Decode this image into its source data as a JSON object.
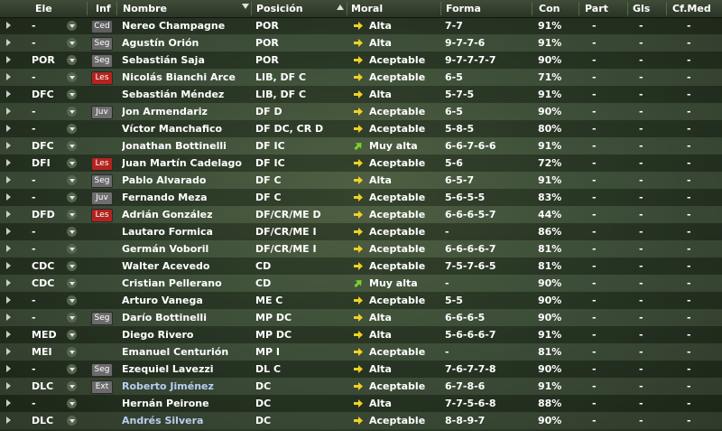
{
  "columns": {
    "ele": "Ele",
    "inf": "Inf",
    "nombre": "Nombre",
    "posicion": "Posición",
    "moral": "Moral",
    "forma": "Forma",
    "con": "Con",
    "part": "Part",
    "gls": "Gls",
    "cfmed": "Cf.Med"
  },
  "colors": {
    "badge_ced": "#5f5f5f",
    "badge_seg": "#6b6b6b",
    "badge_les": "#b3241e",
    "badge_juv": "#6e6e6e",
    "badge_ext": "#6b6b6b",
    "arrow_yellow": "#f2d024",
    "arrow_green": "#7ad12a",
    "link": "#b8cff2"
  },
  "players": [
    {
      "ele": "-",
      "inf": "Ced",
      "nombre": "Nereo Champagne",
      "posicion": "POR",
      "moral": "Alta",
      "forma": "7-7",
      "con": "91%",
      "part": "-",
      "gls": "-",
      "cf": "-"
    },
    {
      "ele": "-",
      "inf": "Seg",
      "nombre": "Agustín Orión",
      "posicion": "POR",
      "moral": "Alta",
      "forma": "9-7-7-6",
      "con": "91%",
      "part": "-",
      "gls": "-",
      "cf": "-"
    },
    {
      "ele": "POR",
      "inf": "Seg",
      "nombre": "Sebastián Saja",
      "posicion": "POR",
      "moral": "Aceptable",
      "forma": "9-7-7-7-7",
      "con": "90%",
      "part": "-",
      "gls": "-",
      "cf": "-"
    },
    {
      "ele": "-",
      "inf": "Les",
      "nombre": "Nicolás Bianchi Arce",
      "posicion": "LIB, DF C",
      "moral": "Aceptable",
      "forma": "6-5",
      "con": "71%",
      "part": "-",
      "gls": "-",
      "cf": "-"
    },
    {
      "ele": "DFC",
      "inf": "",
      "nombre": "Sebastián Méndez",
      "posicion": "LIB, DF C",
      "moral": "Alta",
      "forma": "5-7-5",
      "con": "91%",
      "part": "-",
      "gls": "-",
      "cf": "-"
    },
    {
      "ele": "-",
      "inf": "Juv",
      "nombre": "Jon Armendariz",
      "posicion": "DF D",
      "moral": "Aceptable",
      "forma": "6-5",
      "con": "90%",
      "part": "-",
      "gls": "-",
      "cf": "-"
    },
    {
      "ele": "-",
      "inf": "",
      "nombre": "Víctor Manchafico",
      "posicion": "DF DC, CR D",
      "moral": "Aceptable",
      "forma": "5-8-5",
      "con": "80%",
      "part": "-",
      "gls": "-",
      "cf": "-"
    },
    {
      "ele": "DFC",
      "inf": "",
      "nombre": "Jonathan Bottinelli",
      "posicion": "DF IC",
      "moral": "Muy alta",
      "forma": "6-6-7-6-6",
      "con": "91%",
      "part": "-",
      "gls": "-",
      "cf": "-"
    },
    {
      "ele": "DFI",
      "inf": "Les",
      "nombre": "Juan Martín Cadelago",
      "posicion": "DF IC",
      "moral": "Aceptable",
      "forma": "5-6",
      "con": "72%",
      "part": "-",
      "gls": "-",
      "cf": "-"
    },
    {
      "ele": "-",
      "inf": "Seg",
      "nombre": "Pablo Alvarado",
      "posicion": "DF C",
      "moral": "Alta",
      "forma": "6-5-7",
      "con": "91%",
      "part": "-",
      "gls": "-",
      "cf": "-"
    },
    {
      "ele": "-",
      "inf": "Juv",
      "nombre": "Fernando Meza",
      "posicion": "DF C",
      "moral": "Aceptable",
      "forma": "5-6-5-5",
      "con": "83%",
      "part": "-",
      "gls": "-",
      "cf": "-"
    },
    {
      "ele": "DFD",
      "inf": "Les",
      "nombre": "Adrián González",
      "posicion": "DF/CR/ME D",
      "moral": "Aceptable",
      "forma": "6-6-6-5-7",
      "con": "44%",
      "part": "-",
      "gls": "-",
      "cf": "-"
    },
    {
      "ele": "-",
      "inf": "",
      "nombre": "Lautaro Formica",
      "posicion": "DF/CR/ME I",
      "moral": "Aceptable",
      "forma": "-",
      "con": "86%",
      "part": "-",
      "gls": "-",
      "cf": "-"
    },
    {
      "ele": "-",
      "inf": "",
      "nombre": "Germán Voboril",
      "posicion": "DF/CR/ME I",
      "moral": "Aceptable",
      "forma": "6-6-6-6-7",
      "con": "81%",
      "part": "-",
      "gls": "-",
      "cf": "-"
    },
    {
      "ele": "CDC",
      "inf": "",
      "nombre": "Walter Acevedo",
      "posicion": "CD",
      "moral": "Aceptable",
      "forma": "7-5-7-6-5",
      "con": "81%",
      "part": "-",
      "gls": "-",
      "cf": "-"
    },
    {
      "ele": "CDC",
      "inf": "",
      "nombre": "Cristian Pellerano",
      "posicion": "CD",
      "moral": "Muy alta",
      "forma": "-",
      "con": "90%",
      "part": "-",
      "gls": "-",
      "cf": "-"
    },
    {
      "ele": "-",
      "inf": "",
      "nombre": "Arturo Vanega",
      "posicion": "ME C",
      "moral": "Aceptable",
      "forma": "5-5",
      "con": "90%",
      "part": "-",
      "gls": "-",
      "cf": "-"
    },
    {
      "ele": "-",
      "inf": "Seg",
      "nombre": "Darío Bottinelli",
      "posicion": "MP DC",
      "moral": "Alta",
      "forma": "6-6-6-5",
      "con": "90%",
      "part": "-",
      "gls": "-",
      "cf": "-"
    },
    {
      "ele": "MED",
      "inf": "",
      "nombre": "Diego Rivero",
      "posicion": "MP DC",
      "moral": "Alta",
      "forma": "5-6-6-6-7",
      "con": "91%",
      "part": "-",
      "gls": "-",
      "cf": "-"
    },
    {
      "ele": "MEI",
      "inf": "",
      "nombre": "Emanuel Centurión",
      "posicion": "MP I",
      "moral": "Aceptable",
      "forma": "-",
      "con": "81%",
      "part": "-",
      "gls": "-",
      "cf": "-"
    },
    {
      "ele": "-",
      "inf": "Seg",
      "nombre": "Ezequiel Lavezzi",
      "posicion": "DL C",
      "moral": "Alta",
      "forma": "7-6-7-7-8",
      "con": "90%",
      "part": "-",
      "gls": "-",
      "cf": "-"
    },
    {
      "ele": "DLC",
      "inf": "Ext",
      "nombre": "Roberto Jiménez",
      "posicion": "DC",
      "moral": "Aceptable",
      "forma": "6-7-8-6",
      "con": "91%",
      "part": "-",
      "gls": "-",
      "cf": "-",
      "link": true
    },
    {
      "ele": "-",
      "inf": "",
      "nombre": "Hernán Peirone",
      "posicion": "DC",
      "moral": "Alta",
      "forma": "7-7-5-6-8",
      "con": "88%",
      "part": "-",
      "gls": "-",
      "cf": "-"
    },
    {
      "ele": "DLC",
      "inf": "",
      "nombre": "Andrés Silvera",
      "posicion": "DC",
      "moral": "Aceptable",
      "forma": "8-8-9-7",
      "con": "90%",
      "part": "-",
      "gls": "-",
      "cf": "-",
      "link": true
    }
  ]
}
